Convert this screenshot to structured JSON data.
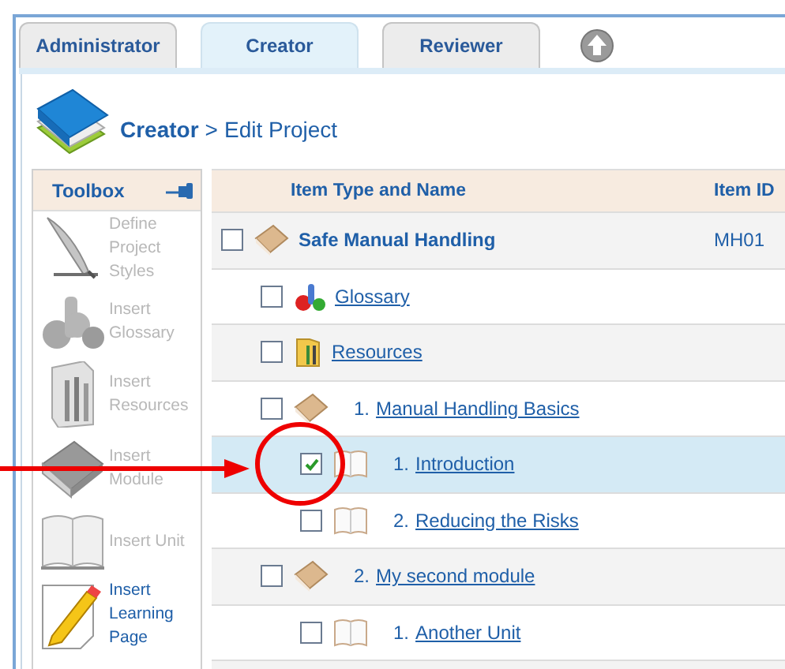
{
  "tabs": [
    {
      "label": "Administrator",
      "selected": false
    },
    {
      "label": "Creator",
      "selected": true
    },
    {
      "label": "Reviewer",
      "selected": false
    }
  ],
  "breadcrumb": {
    "section": "Creator",
    "separator": ">",
    "page": "Edit Project"
  },
  "toolbox": {
    "title": "Toolbox",
    "items": [
      {
        "kind": "styles",
        "label": "Define Project Styles",
        "disabled": true
      },
      {
        "kind": "glossary",
        "label": "Insert Glossary",
        "disabled": true
      },
      {
        "kind": "resources",
        "label": "Insert Resources",
        "disabled": true
      },
      {
        "kind": "module",
        "label": "Insert Module",
        "disabled": true
      },
      {
        "kind": "unit",
        "label": "Insert Unit",
        "disabled": true
      },
      {
        "kind": "page",
        "label": "Insert Learning Page",
        "disabled": false
      }
    ]
  },
  "table": {
    "columns": [
      "Item Type and Name",
      "Item ID"
    ],
    "rows": [
      {
        "kind": "course",
        "name": "Safe Manual Handling",
        "item_id": "MH01",
        "checked": false,
        "selected": false,
        "children": [
          {
            "kind": "glossary",
            "name": "Glossary",
            "checked": false,
            "selected": false
          },
          {
            "kind": "resources",
            "name": "Resources",
            "checked": false,
            "selected": false
          },
          {
            "kind": "module",
            "number": "1.",
            "name": "Manual Handling Basics",
            "checked": false,
            "selected": false,
            "children": [
              {
                "kind": "unit",
                "number": "1.",
                "name": "Introduction",
                "checked": true,
                "selected": true
              },
              {
                "kind": "unit",
                "number": "2.",
                "name": "Reducing the Risks",
                "checked": false,
                "selected": false
              }
            ]
          },
          {
            "kind": "module",
            "number": "2.",
            "name": "My second module",
            "checked": false,
            "selected": false,
            "children": [
              {
                "kind": "unit",
                "number": "1.",
                "name": "Another Unit",
                "checked": false,
                "selected": false
              }
            ]
          }
        ]
      }
    ]
  }
}
